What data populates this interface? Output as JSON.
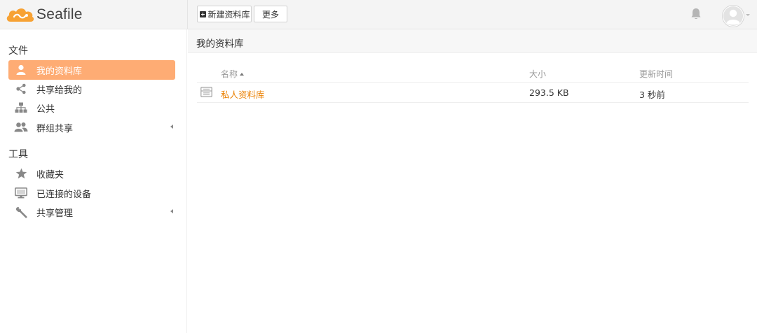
{
  "app": {
    "logo_text": "Seafile"
  },
  "toolbar": {
    "new_library_label": "新建资料库",
    "more_label": "更多"
  },
  "sidebar": {
    "files_heading": "文件",
    "tools_heading": "工具",
    "file_items": [
      {
        "label": "我的资料库",
        "icon": "user-icon",
        "active": true
      },
      {
        "label": "共享给我的",
        "icon": "share-icon"
      },
      {
        "label": "公共",
        "icon": "sitemap-icon"
      },
      {
        "label": "群组共享",
        "icon": "group-icon",
        "expandable": true
      }
    ],
    "tool_items": [
      {
        "label": "收藏夹",
        "icon": "star-icon"
      },
      {
        "label": "已连接的设备",
        "icon": "monitor-icon"
      },
      {
        "label": "共享管理",
        "icon": "wrench-icon",
        "expandable": true
      }
    ]
  },
  "main": {
    "title": "我的资料库",
    "columns": {
      "name": "名称",
      "size": "大小",
      "modified": "更新时间"
    },
    "rows": [
      {
        "name": "私人资料库",
        "size": "293.5 KB",
        "modified": "3 秒前",
        "icon": "library-icon"
      }
    ]
  },
  "colors": {
    "accent": "#feac74",
    "link": "#eb8205",
    "logo_orange": "#f7a234"
  }
}
